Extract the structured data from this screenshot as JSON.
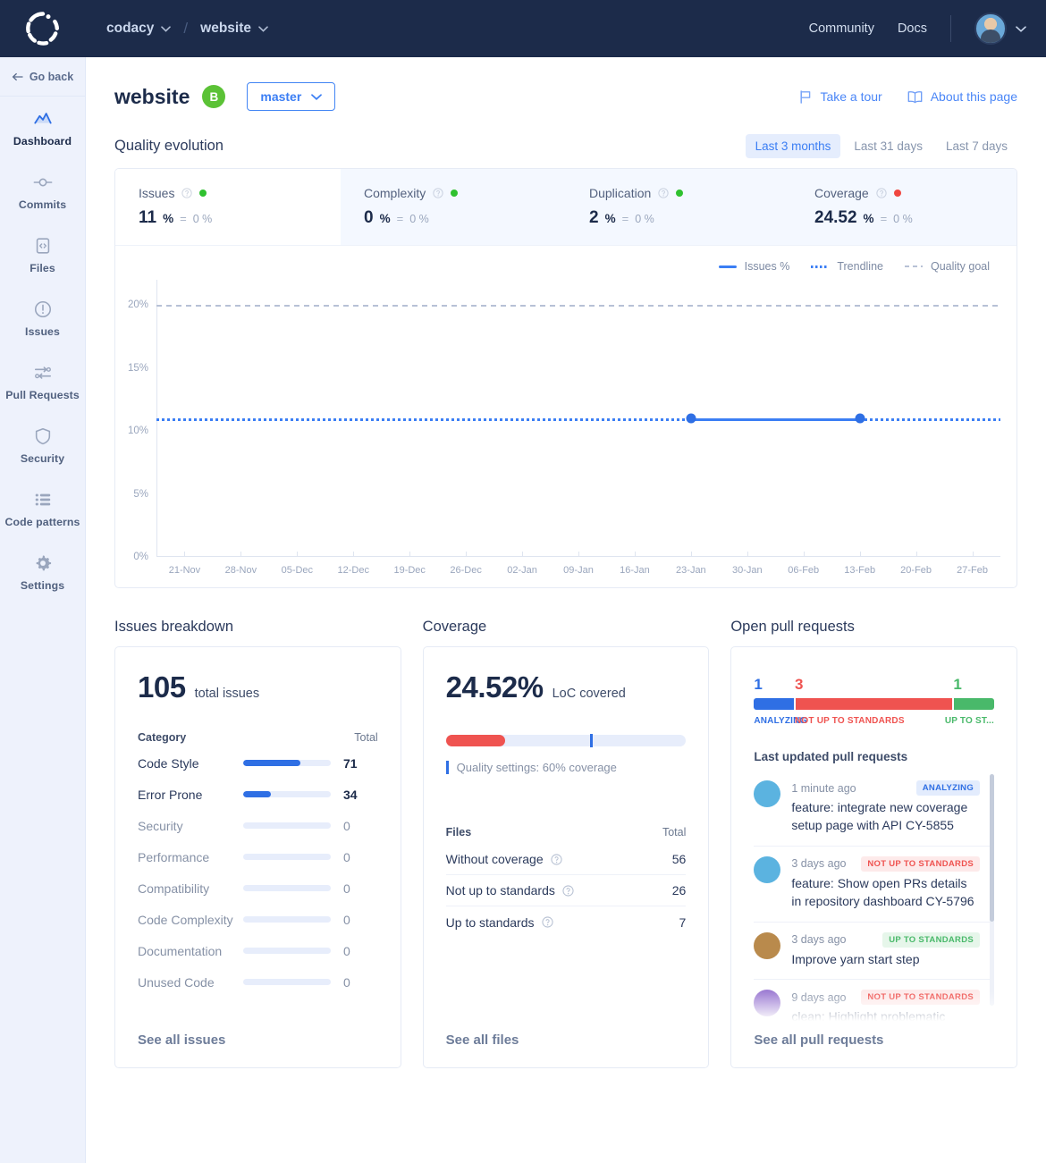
{
  "topbar": {
    "logo_name": "codacy-logo",
    "org": "codacy",
    "repo": "website",
    "separator": "/",
    "community": "Community",
    "docs": "Docs"
  },
  "sidebar": {
    "go_back": "Go back",
    "items": [
      {
        "label": "Dashboard",
        "icon": "chart-line-icon",
        "active": true
      },
      {
        "label": "Commits",
        "icon": "commit-icon",
        "active": false
      },
      {
        "label": "Files",
        "icon": "file-code-icon",
        "active": false
      },
      {
        "label": "Issues",
        "icon": "alert-circle-icon",
        "active": false
      },
      {
        "label": "Pull Requests",
        "icon": "pull-request-icon",
        "active": false
      },
      {
        "label": "Security",
        "icon": "shield-icon",
        "active": false
      },
      {
        "label": "Code patterns",
        "icon": "list-icon",
        "active": false
      },
      {
        "label": "Settings",
        "icon": "gear-icon",
        "active": false
      }
    ]
  },
  "page": {
    "title": "website",
    "grade": "B",
    "branch": "master",
    "take_a_tour": "Take a tour",
    "about_this_page": "About this page"
  },
  "quality_evolution": {
    "title": "Quality evolution",
    "ranges": [
      {
        "label": "Last 3 months",
        "active": true
      },
      {
        "label": "Last 31 days",
        "active": false
      },
      {
        "label": "Last 7 days",
        "active": false
      }
    ],
    "metrics": [
      {
        "name": "Issues",
        "value": "11",
        "unit": "%",
        "eq": "=",
        "delta": "0 %",
        "status_color": "#2fc12f",
        "active": true
      },
      {
        "name": "Complexity",
        "value": "0",
        "unit": "%",
        "eq": "=",
        "delta": "0 %",
        "status_color": "#2fc12f",
        "active": false
      },
      {
        "name": "Duplication",
        "value": "2",
        "unit": "%",
        "eq": "=",
        "delta": "0 %",
        "status_color": "#2fc12f",
        "active": false
      },
      {
        "name": "Coverage",
        "value": "24.52",
        "unit": "%",
        "eq": "=",
        "delta": "0 %",
        "status_color": "#f0463f",
        "active": false
      }
    ],
    "legend": [
      {
        "label": "Issues %",
        "style": "solid",
        "color": "#3b7ef4"
      },
      {
        "label": "Trendline",
        "style": "dotted",
        "color": "#3b7ef4"
      },
      {
        "label": "Quality goal",
        "style": "dashed",
        "color": "#b7c1d6"
      }
    ]
  },
  "chart_data": {
    "type": "line",
    "title": "Quality evolution",
    "xlabel": "",
    "ylabel": "",
    "ylim": [
      0,
      22
    ],
    "yticks": [
      0,
      5,
      10,
      15,
      20
    ],
    "ytick_labels": [
      "0%",
      "5%",
      "10%",
      "15%",
      "20%"
    ],
    "grid": false,
    "legend_position": "top-right",
    "x": [
      "21-Nov",
      "28-Nov",
      "05-Dec",
      "12-Dec",
      "19-Dec",
      "26-Dec",
      "02-Jan",
      "09-Jan",
      "16-Jan",
      "23-Jan",
      "30-Jan",
      "06-Feb",
      "13-Feb",
      "20-Feb",
      "27-Feb"
    ],
    "series": [
      {
        "name": "Issues %",
        "style": "solid",
        "color": "#3b7ef4",
        "points": [
          {
            "x": "23-Jan",
            "y": 11
          },
          {
            "x": "13-Feb",
            "y": 11
          }
        ]
      },
      {
        "name": "Trendline",
        "style": "dotted",
        "color": "#3b7ef4",
        "value": 11
      },
      {
        "name": "Quality goal",
        "style": "dashed",
        "color": "#b7c1d6",
        "value": 20
      }
    ]
  },
  "issues_breakdown": {
    "title": "Issues breakdown",
    "total": "105",
    "total_label": "total issues",
    "col_category": "Category",
    "col_total": "Total",
    "rows": [
      {
        "category": "Code Style",
        "total": "71",
        "pct": 65
      },
      {
        "category": "Error Prone",
        "total": "34",
        "pct": 32
      },
      {
        "category": "Security",
        "total": "0",
        "pct": 0
      },
      {
        "category": "Performance",
        "total": "0",
        "pct": 0
      },
      {
        "category": "Compatibility",
        "total": "0",
        "pct": 0
      },
      {
        "category": "Code Complexity",
        "total": "0",
        "pct": 0
      },
      {
        "category": "Documentation",
        "total": "0",
        "pct": 0
      },
      {
        "category": "Unused Code",
        "total": "0",
        "pct": 0
      }
    ],
    "see_all": "See all issues"
  },
  "coverage": {
    "title": "Coverage",
    "value": "24.52%",
    "value_label": "LoC covered",
    "bar_pct": 24.52,
    "goal_pct": 60,
    "goal_note": "Quality settings: 60% coverage",
    "col_files": "Files",
    "col_total": "Total",
    "rows": [
      {
        "label": "Without coverage",
        "total": "56"
      },
      {
        "label": "Not up to standards",
        "total": "26"
      },
      {
        "label": "Up to standards",
        "total": "7"
      }
    ],
    "see_all": "See all files"
  },
  "pull_requests": {
    "title": "Open pull requests",
    "segments": [
      {
        "count": "1",
        "label": "ANALYZING",
        "color": "#2f6fe4",
        "pct": 17
      },
      {
        "count": "3",
        "label": "NOT UP TO STANDARDS",
        "color": "#ef5350",
        "pct": 66
      },
      {
        "count": "1",
        "label": "UP TO ST...",
        "color": "#49b96a",
        "pct": 17
      }
    ],
    "list_title": "Last updated pull requests",
    "items": [
      {
        "time": "1 minute ago",
        "badge": "ANALYZING",
        "badge_fg": "#2f6fe4",
        "badge_bg": "#e3ecfd",
        "avatar": "#5bb3e0",
        "title": "feature: integrate new coverage setup page with API CY-5855"
      },
      {
        "time": "3 days ago",
        "badge": "NOT UP TO STANDARDS",
        "badge_fg": "#ef5350",
        "badge_bg": "#fdeaea",
        "avatar": "#5bb3e0",
        "title": "feature: Show open PRs details in repository dashboard CY-5796"
      },
      {
        "time": "3 days ago",
        "badge": "UP TO STANDARDS",
        "badge_fg": "#49b96a",
        "badge_bg": "#e6f6ea",
        "avatar": "#b98a4c",
        "title": "Improve yarn start step"
      },
      {
        "time": "9 days ago",
        "badge": "NOT UP TO STANDARDS",
        "badge_fg": "#ef5350",
        "badge_bg": "#fdeaea",
        "avatar": "#9f7fd4",
        "title": "clean: Highlight problematic"
      }
    ],
    "see_all": "See all pull requests"
  }
}
